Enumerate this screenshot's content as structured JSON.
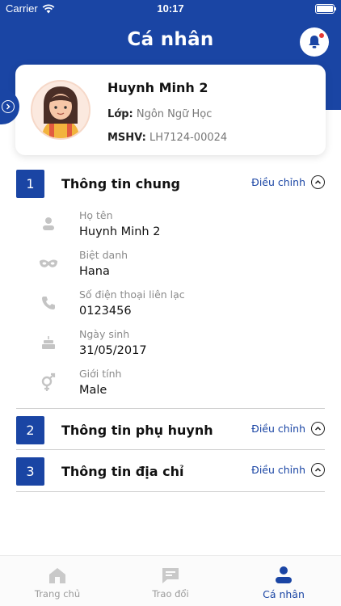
{
  "status_bar": {
    "carrier": "Carrier",
    "time": "10:17"
  },
  "header": {
    "title": "Cá nhân"
  },
  "profile": {
    "name": "Huynh Minh 2",
    "class_label": "Lớp:",
    "class_value": "Ngôn Ngữ Học",
    "id_label": "MSHV:",
    "id_value": "LH7124-00024"
  },
  "sections": [
    {
      "number": "1",
      "title": "Thông tin chung",
      "edit_label": "Điều chỉnh"
    },
    {
      "number": "2",
      "title": "Thông tin phụ huynh",
      "edit_label": "Điều chỉnh"
    },
    {
      "number": "3",
      "title": "Thông tin địa chỉ",
      "edit_label": "Điều chỉnh"
    }
  ],
  "general_info": [
    {
      "icon": "person-icon",
      "label": "Họ tên",
      "value": "Huynh Minh 2"
    },
    {
      "icon": "nickname-mask-icon",
      "label": "Biệt danh",
      "value": "Hana"
    },
    {
      "icon": "phone-icon",
      "label": "Số điện thoại liên lạc",
      "value": "0123456"
    },
    {
      "icon": "birthday-cake-icon",
      "label": "Ngày sinh",
      "value": "31/05/2017"
    },
    {
      "icon": "gender-icon",
      "label": "Giới tính",
      "value": "Male"
    }
  ],
  "tabs": [
    {
      "icon": "home-icon",
      "label": "Trang chủ"
    },
    {
      "icon": "chat-icon",
      "label": "Trao đổi"
    },
    {
      "icon": "profile-icon",
      "label": "Cá nhân"
    }
  ],
  "colors": {
    "primary": "#1a45a4",
    "notification": "#e53935",
    "muted": "#8a8a8a"
  }
}
